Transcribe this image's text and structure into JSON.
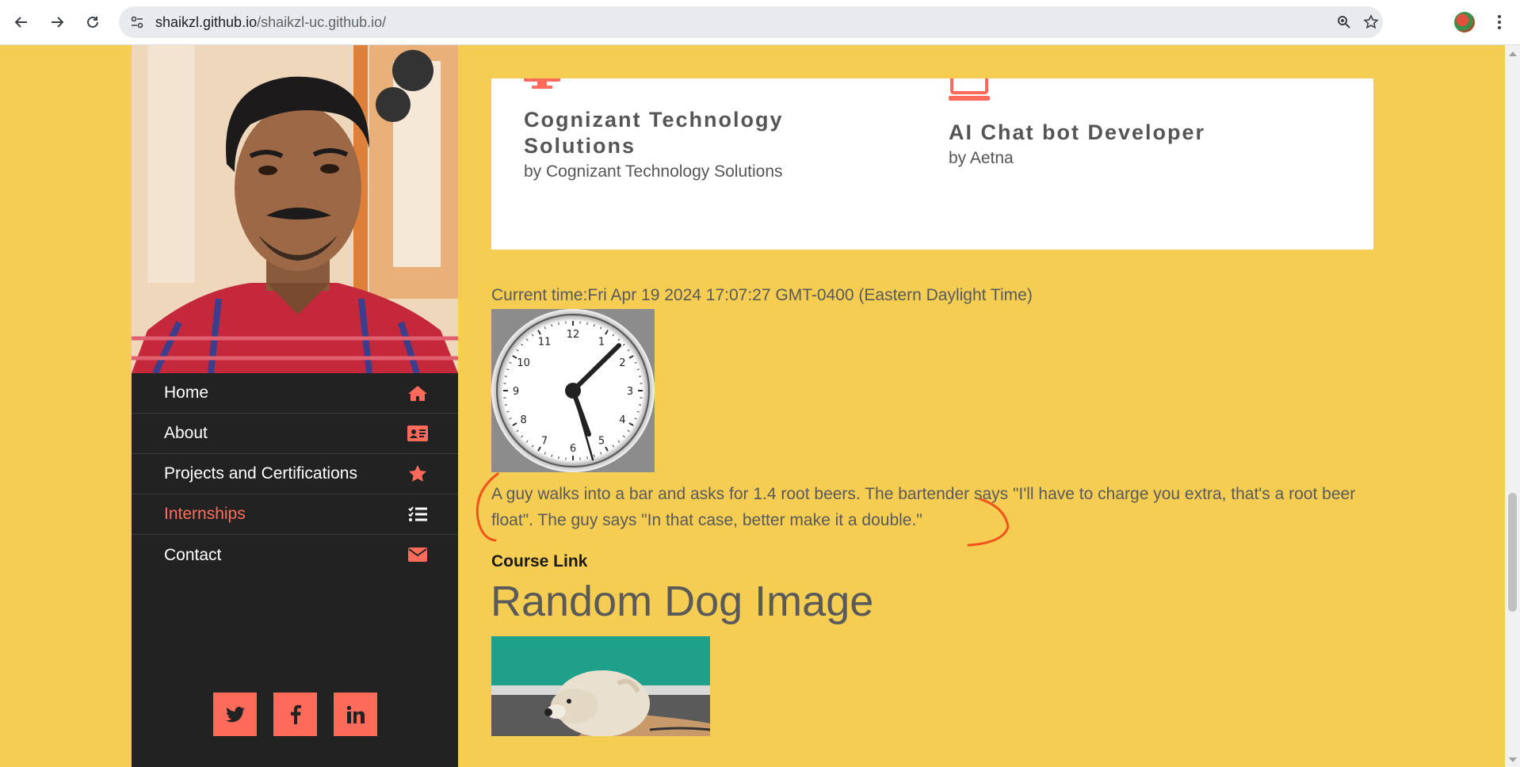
{
  "browser": {
    "url_host": "shaikzl.github.io",
    "url_path": "/shaikzl-uc.github.io/"
  },
  "sidebar": {
    "nav": [
      {
        "label": "Home",
        "icon": "home-icon",
        "active": false
      },
      {
        "label": "About",
        "icon": "id-card-icon",
        "active": false
      },
      {
        "label": "Projects and Certifications",
        "icon": "star-icon",
        "active": false
      },
      {
        "label": "Internships",
        "icon": "list-check-icon",
        "active": true
      },
      {
        "label": "Contact",
        "icon": "envelope-icon",
        "active": false
      }
    ],
    "socials": [
      "twitter-icon",
      "facebook-icon",
      "linkedin-icon"
    ]
  },
  "internships": [
    {
      "title": "Cognizant Technology Solutions",
      "by": "by Cognizant Technology Solutions",
      "icon": "desktop-icon"
    },
    {
      "title": "AI Chat bot Developer",
      "by": "by Aetna",
      "icon": "laptop-icon"
    }
  ],
  "clock": {
    "current_time": "Current time:Fri Apr 19 2024 17:07:27 GMT-0400 (Eastern Daylight Time)",
    "numerals": [
      "12",
      "1",
      "2",
      "3",
      "4",
      "5",
      "6",
      "7",
      "8",
      "9",
      "10",
      "11"
    ]
  },
  "joke": "A guy walks into a bar and asks for 1.4 root beers. The bartender says \"I'll have to charge you extra, that's a root beer float\". The guy says \"In that case, better make it a double.\"",
  "course_link": "Course Link",
  "dog_title": "Random Dog Image",
  "colors": {
    "page_bg": "#f5cd52",
    "sidebar_bg": "#222222",
    "accent": "#fe6b5b",
    "text": "#5a5a5a"
  }
}
